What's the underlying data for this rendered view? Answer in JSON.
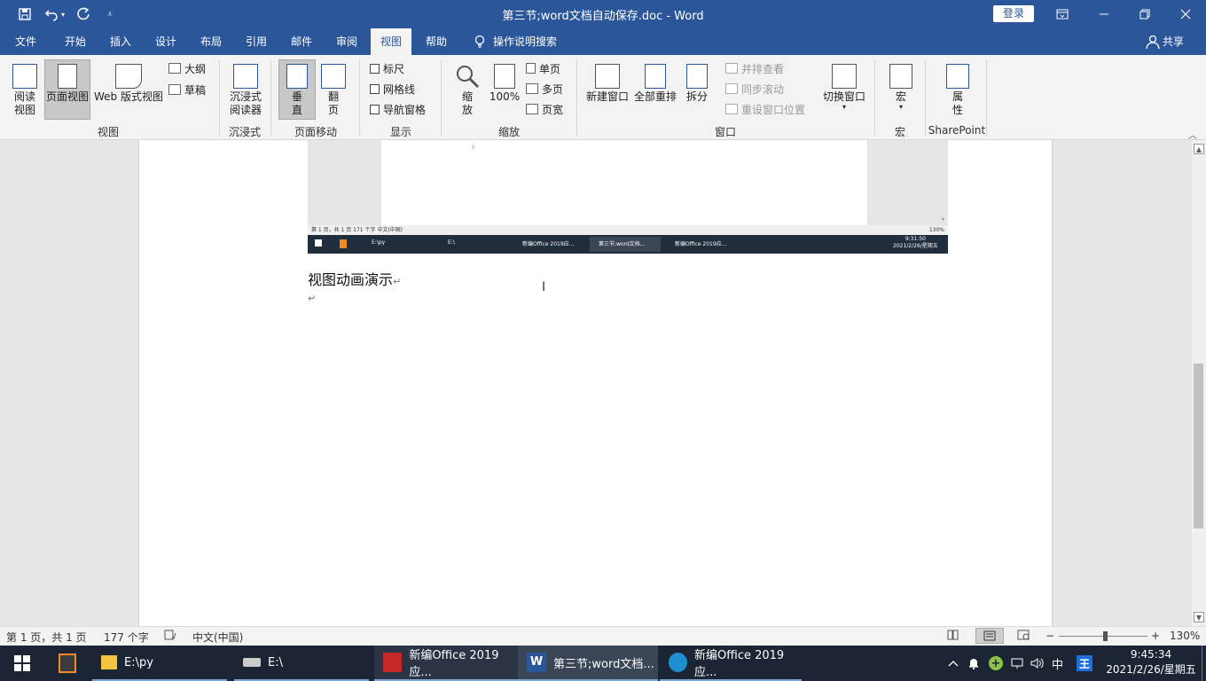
{
  "titlebar": {
    "title": "第三节;word文档自动保存.doc  -  Word",
    "login": "登录",
    "quick_access": [
      "save-icon",
      "undo-icon",
      "redo-icon",
      "customize-icon"
    ]
  },
  "menu": {
    "items": [
      "文件",
      "开始",
      "插入",
      "设计",
      "布局",
      "引用",
      "邮件",
      "审阅",
      "视图",
      "帮助"
    ],
    "active": "视图",
    "tell_me": "操作说明搜索",
    "share": "共享"
  },
  "ribbon": {
    "views": {
      "read": "阅读\n视图",
      "print": "页面视图",
      "web": "Web 版式视图",
      "outline": "大纲",
      "draft": "草稿",
      "label": "视图"
    },
    "immersive": {
      "reader": "沉浸式\n阅读器",
      "label": "沉浸式"
    },
    "page_move": {
      "vertical": "垂\n直",
      "side": "翻\n页",
      "label": "页面移动"
    },
    "show": {
      "ruler": "标尺",
      "gridlines": "网格线",
      "nav": "导航窗格",
      "label": "显示"
    },
    "zoom": {
      "zoom": "缩\n放",
      "hundred": "100%",
      "one_page": "单页",
      "multi_page": "多页",
      "page_width": "页宽",
      "label": "缩放"
    },
    "window": {
      "new": "新建窗口",
      "arrange": "全部重排",
      "split": "拆分",
      "side_by_side": "并排查看",
      "sync_scroll": "同步滚动",
      "reset_pos": "重设窗口位置",
      "switch": "切换窗口",
      "label": "窗口"
    },
    "macros": {
      "macro": "宏",
      "label": "宏"
    },
    "sharepoint": {
      "props": "属\n性",
      "label": "SharePoint"
    }
  },
  "document": {
    "heading_text": "视图动画演示",
    "para_mark": "↵",
    "embedded": {
      "status_left": "第 1 页，共 1 页    171 个字    中文(中国)",
      "status_right": "130%",
      "task_items": [
        "E:\\py",
        "E:\\",
        "新编Office 2019应...",
        "第三节;word文档...",
        "新编Office 2019应..."
      ],
      "clock_time": "9:31:50",
      "clock_date": "2021/2/26/星期五"
    }
  },
  "statusbar": {
    "page": "第 1 页，共 1 页",
    "words": "177 个字",
    "language": "中文(中国)",
    "zoom": "130%",
    "zoom_minus": "−",
    "zoom_plus": "+"
  },
  "taskbar": {
    "items": [
      {
        "label": "E:\\py"
      },
      {
        "label": "E:\\"
      },
      {
        "label": "新编Office 2019应..."
      },
      {
        "label": "第三节;word文档..."
      },
      {
        "label": "新编Office 2019应..."
      }
    ],
    "ime": "中",
    "time": "9:45:34",
    "date": "2021/2/26/星期五"
  },
  "colors": {
    "word_blue": "#2b579a",
    "taskbar": "#1c2533",
    "ribbon": "#f3f3f3"
  }
}
